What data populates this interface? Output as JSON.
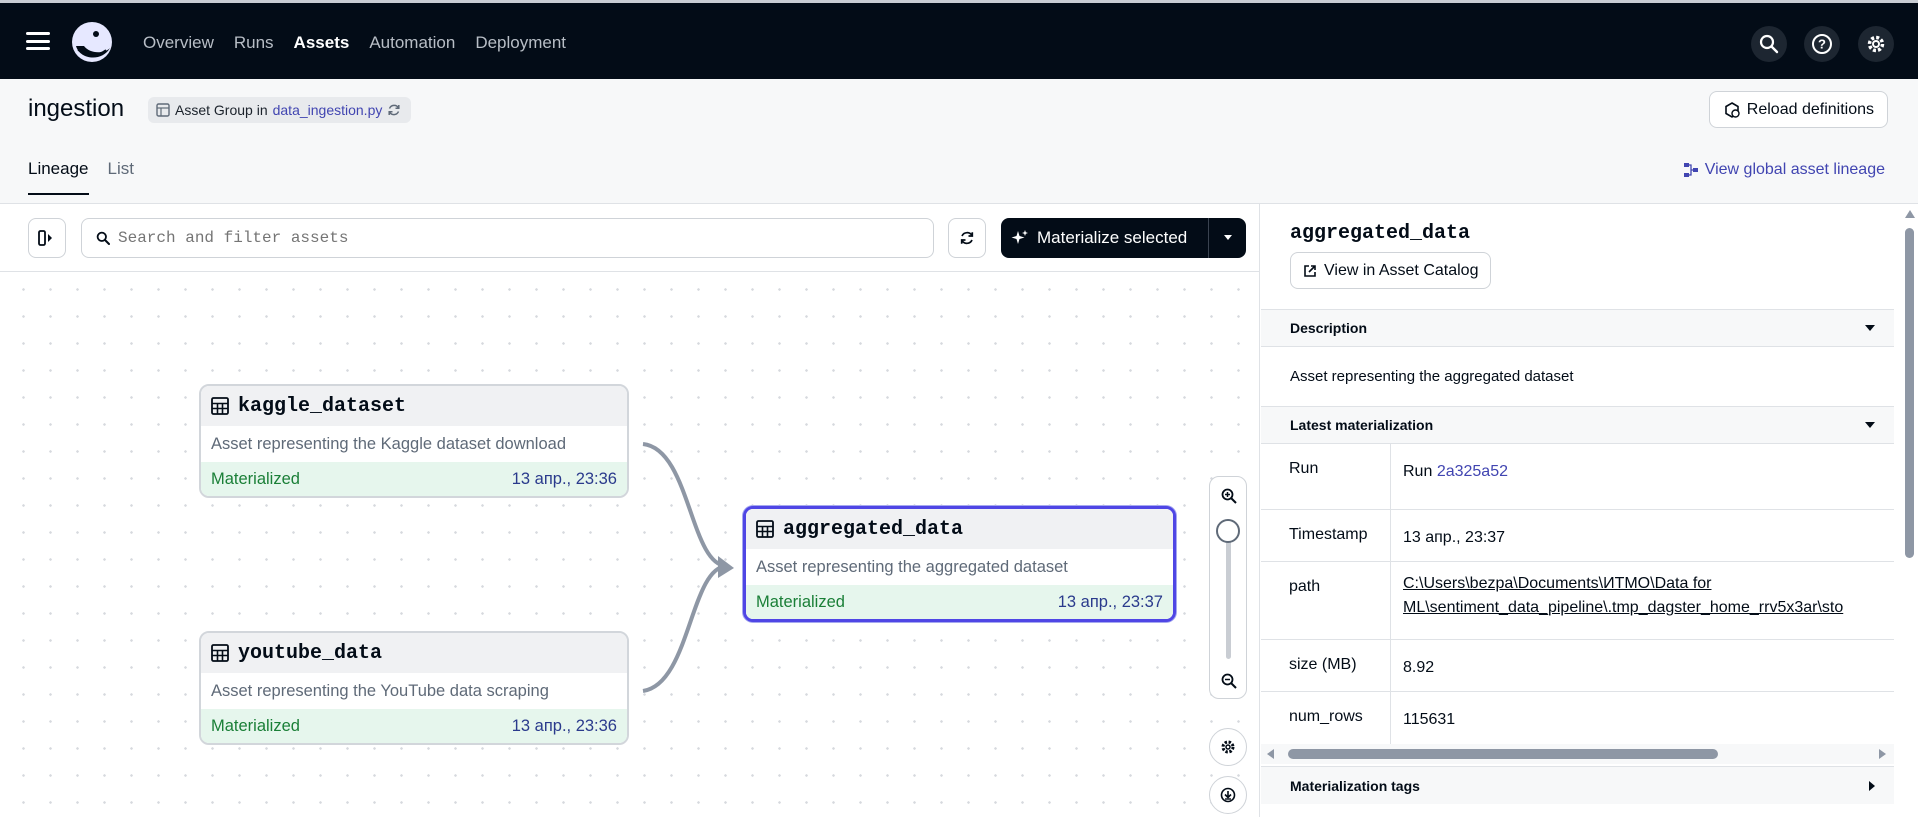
{
  "nav": {
    "items": [
      "Overview",
      "Runs",
      "Assets",
      "Automation",
      "Deployment"
    ],
    "active": "Assets"
  },
  "header": {
    "title": "ingestion",
    "chip_prefix": "Asset Group in",
    "chip_file": "data_ingestion.py",
    "reload_label": "Reload definitions",
    "tabs": [
      "Lineage",
      "List"
    ],
    "active_tab": "Lineage",
    "global_lineage_label": "View global asset lineage"
  },
  "toolbar": {
    "search_placeholder": "Search and filter assets",
    "materialize_label": "Materialize selected"
  },
  "graph": {
    "nodes": [
      {
        "name": "kaggle_dataset",
        "description": "Asset representing the Kaggle dataset download",
        "status": "Materialized",
        "timestamp": "13 апр., 23:36"
      },
      {
        "name": "youtube_data",
        "description": "Asset representing the YouTube data scraping",
        "status": "Materialized",
        "timestamp": "13 апр., 23:36"
      },
      {
        "name": "aggregated_data",
        "description": "Asset representing the aggregated dataset",
        "status": "Materialized",
        "timestamp": "13 апр., 23:37"
      }
    ]
  },
  "panel": {
    "title": "aggregated_data",
    "catalog_label": "View in Asset Catalog",
    "description_header": "Description",
    "description": "Asset representing the aggregated dataset",
    "latest_header": "Latest materialization",
    "rows": {
      "run_key": "Run",
      "run_prefix": "Run",
      "run_id": "2a325a52",
      "timestamp_key": "Timestamp",
      "timestamp": "13 апр., 23:37",
      "path_key": "path",
      "path_line1": "C:\\Users\\bezpa\\Documents\\ИТМО\\Data for",
      "path_line2": "ML\\sentiment_data_pipeline\\.tmp_dagster_home_rrv5x3ar\\sto",
      "size_key": "size (MB)",
      "size": "8.92",
      "rows_key": "num_rows",
      "num_rows": "115631"
    },
    "tags_header": "Materialization tags"
  }
}
